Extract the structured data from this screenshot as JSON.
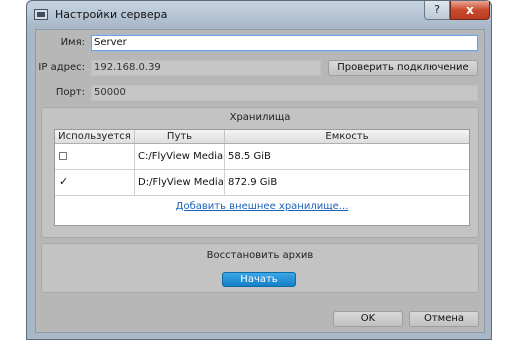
{
  "window": {
    "title": "Настройки сервера",
    "help_label": "?",
    "close_label": "x"
  },
  "form": {
    "name_label": "Имя:",
    "name_value": "Server",
    "ip_label": "IP адрес:",
    "ip_value": "192.168.0.39",
    "check_connection_label": "Проверить подключение",
    "port_label": "Порт:",
    "port_value": "50000"
  },
  "storage": {
    "title": "Хранилища",
    "columns": [
      "Используется",
      "Путь",
      "Емкость"
    ],
    "rows": [
      {
        "used": false,
        "path": "C:/FlyView Media",
        "capacity": "58.5 GiB"
      },
      {
        "used": true,
        "path": "D:/FlyView Media",
        "capacity": "872.9 GiB"
      }
    ],
    "checkmark": "✓",
    "add_external_label": "Добавить внешнее хранилище..."
  },
  "archive": {
    "title": "Восстановить архив",
    "start_label": "Начать"
  },
  "footer": {
    "ok_label": "OK",
    "cancel_label": "Отмена"
  }
}
